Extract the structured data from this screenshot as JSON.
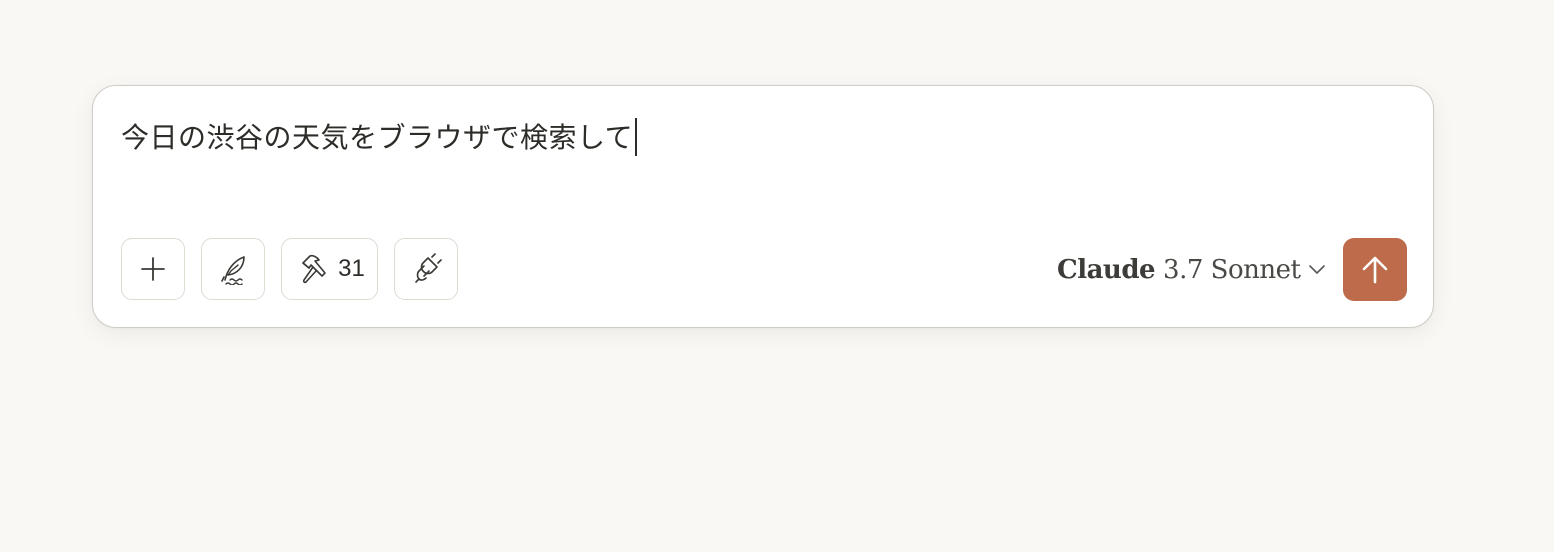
{
  "composer": {
    "prompt_text": "今日の渋谷の天気をブラウザで検索して",
    "toolbar": {
      "attach_icon": "plus-icon",
      "style_icon": "feather-icon",
      "tools_icon": "hammer-icon",
      "tools_count": "31",
      "integrations_icon": "plug-icon"
    },
    "model": {
      "brand": "Claude",
      "version": "3.7 Sonnet",
      "dropdown_icon": "chevron-down-icon"
    },
    "send": {
      "icon": "arrow-up-icon",
      "color": "#bd6b4b"
    }
  },
  "colors": {
    "background": "#f9f8f5",
    "card": "#ffffff",
    "accent": "#bd6b4b"
  }
}
